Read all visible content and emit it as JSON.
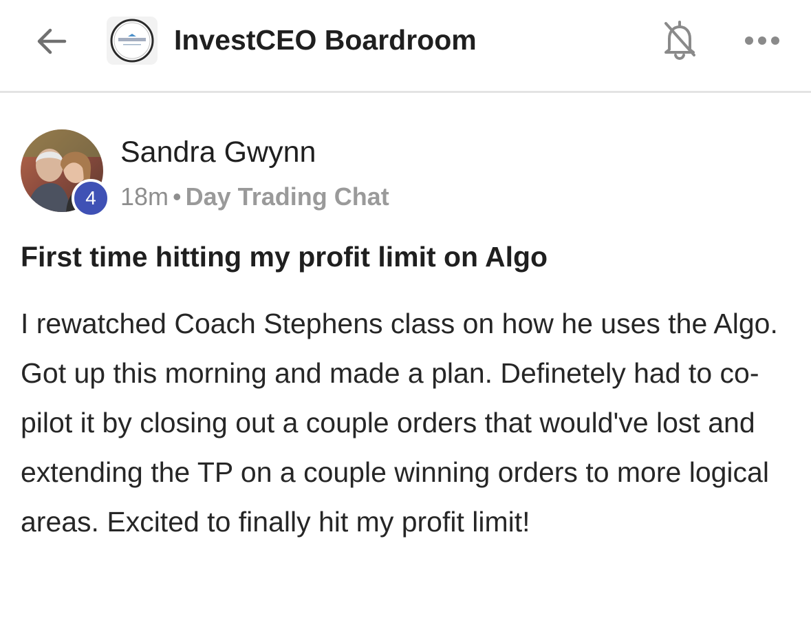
{
  "header": {
    "back_icon": "arrow-left-icon",
    "group_logo_icon": "investceo-logo",
    "group_name": "InvestCEO Boardroom",
    "notification_icon": "bell-muted-icon",
    "more_icon": "more-horizontal-icon"
  },
  "post": {
    "author": {
      "name": "Sandra Gwynn",
      "level": "4",
      "avatar_icon": "user-avatar-photo"
    },
    "time_ago": "18m",
    "separator": "•",
    "channel": "Day Trading Chat",
    "title": "First time hitting my profit limit on Algo",
    "body": "I rewatched Coach Stephens class on how he uses the Algo. Got up this morning and made a plan. Definetely had to co-pilot it by closing out a couple orders that would've lost and extending the TP on a couple winning orders to more logical areas. Excited to finally hit my profit limit!"
  },
  "colors": {
    "text_primary": "#1f1f1f",
    "text_meta": "#8e8e8e",
    "badge": "#3f51b5",
    "divider": "#e3e3e3"
  }
}
